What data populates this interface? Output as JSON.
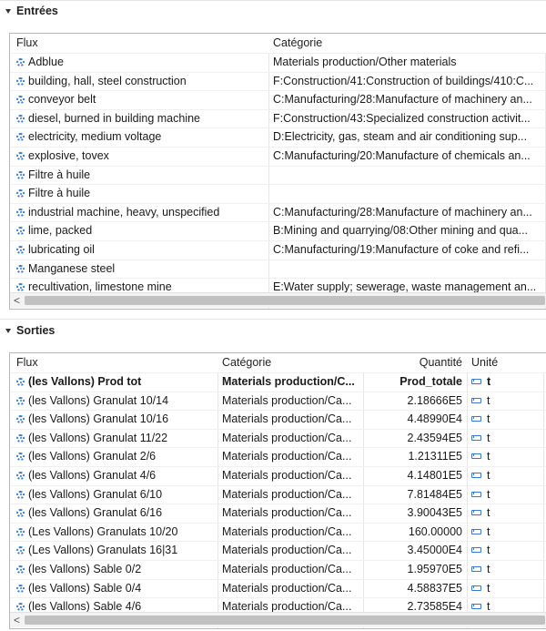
{
  "inputs": {
    "title": "Entrées",
    "columns": [
      "Flux",
      "Catégorie"
    ],
    "rows": [
      {
        "flow": "Adblue",
        "category": "Materials production/Other materials"
      },
      {
        "flow": "building, hall, steel construction",
        "category": "F:Construction/41:Construction of buildings/410:C..."
      },
      {
        "flow": "conveyor belt",
        "category": "C:Manufacturing/28:Manufacture of machinery an..."
      },
      {
        "flow": "diesel, burned in building machine",
        "category": "F:Construction/43:Specialized construction activit..."
      },
      {
        "flow": "electricity, medium voltage",
        "category": "D:Electricity, gas, steam and air conditioning sup..."
      },
      {
        "flow": "explosive, tovex",
        "category": "C:Manufacturing/20:Manufacture of chemicals an..."
      },
      {
        "flow": "Filtre à huile",
        "category": ""
      },
      {
        "flow": "Filtre à huile",
        "category": ""
      },
      {
        "flow": "industrial machine, heavy, unspecified",
        "category": "C:Manufacturing/28:Manufacture of machinery an..."
      },
      {
        "flow": "lime, packed",
        "category": "B:Mining and quarrying/08:Other mining and qua..."
      },
      {
        "flow": "lubricating oil",
        "category": "C:Manufacturing/19:Manufacture of coke and refi..."
      },
      {
        "flow": "Manganese steel",
        "category": ""
      },
      {
        "flow": "recultivation, limestone mine",
        "category": "E:Water supply; sewerage, waste management an..."
      }
    ],
    "scroll_left_label": "<"
  },
  "outputs": {
    "title": "Sorties",
    "columns": [
      "Flux",
      "Catégorie",
      "Quantité",
      "Unité"
    ],
    "rows": [
      {
        "flow": "(les Vallons) Prod tot",
        "category": "Materials production/C...",
        "amount": "Prod_totale",
        "unit": "t",
        "bold": true
      },
      {
        "flow": "(les Vallons) Granulat 10/14",
        "category": "Materials production/Ca...",
        "amount": "2.18666E5",
        "unit": "t"
      },
      {
        "flow": "(les Vallons) Granulat 10/16",
        "category": "Materials production/Ca...",
        "amount": "4.48990E4",
        "unit": "t"
      },
      {
        "flow": "(les Vallons) Granulat 11/22",
        "category": "Materials production/Ca...",
        "amount": "2.43594E5",
        "unit": "t"
      },
      {
        "flow": "(les Vallons) Granulat 2/6",
        "category": "Materials production/Ca...",
        "amount": "1.21311E5",
        "unit": "t"
      },
      {
        "flow": "(les Vallons) Granulat 4/6",
        "category": "Materials production/Ca...",
        "amount": "4.14801E5",
        "unit": "t"
      },
      {
        "flow": "(les Vallons) Granulat 6/10",
        "category": "Materials production/Ca...",
        "amount": "7.81484E5",
        "unit": "t"
      },
      {
        "flow": "(les Vallons) Granulat 6/16",
        "category": "Materials production/Ca...",
        "amount": "3.90043E5",
        "unit": "t"
      },
      {
        "flow": "(Les Vallons) Granulats 10/20",
        "category": "Materials production/Ca...",
        "amount": "160.00000",
        "unit": "t"
      },
      {
        "flow": "(Les Vallons) Granulats 16|31",
        "category": "Materials production/Ca...",
        "amount": "3.45000E4",
        "unit": "t"
      },
      {
        "flow": "(les Vallons) Sable 0/2",
        "category": "Materials production/Ca...",
        "amount": "1.95970E5",
        "unit": "t"
      },
      {
        "flow": "(les Vallons) Sable 0/4",
        "category": "Materials production/Ca...",
        "amount": "4.58837E5",
        "unit": "t"
      },
      {
        "flow": "(les Vallons) Sable 4/6",
        "category": "Materials production/Ca...",
        "amount": "2.73585E4",
        "unit": "t"
      }
    ],
    "scroll_left_label": "<"
  },
  "colors": {
    "icon": "#3a78c9",
    "border": "#b9b9b9"
  },
  "icons": {
    "flow": "flow-gear-icon",
    "unit": "unit-ruler-icon",
    "collapse": "collapse-arrow-icon"
  }
}
